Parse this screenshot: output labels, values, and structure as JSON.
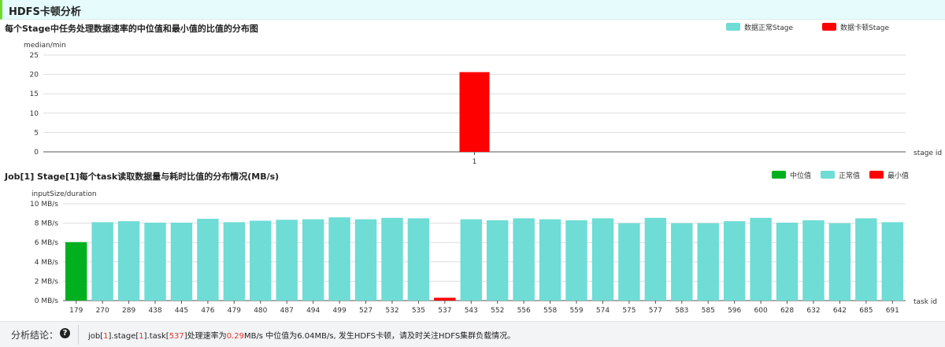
{
  "header": {
    "title": "HDFS卡顿分析"
  },
  "chart_data": [
    {
      "type": "bar",
      "title": "每个Stage中任务处理数据速率的中位值和最小值的比值的分布图",
      "ylabel": "median/min",
      "xlabel": "stage id",
      "ylim": [
        0,
        25
      ],
      "yticks": [
        0,
        5,
        10,
        15,
        20,
        25
      ],
      "grid": true,
      "legend_position": "top-right",
      "legend": [
        {
          "label": "数据正常Stage",
          "color": "#6fdcd6"
        },
        {
          "label": "数据卡顿Stage",
          "color": "#ff0000"
        }
      ],
      "categories": [
        "1"
      ],
      "series": [
        {
          "name": "数据卡顿Stage",
          "values": [
            20.6
          ],
          "color": "#ff0000"
        }
      ]
    },
    {
      "type": "bar",
      "title": "Job[1] Stage[1]每个task读取数据量与耗时比值的分布情况(MB/s)",
      "ylabel": "inputSize/duration",
      "xlabel": "task id",
      "ylim": [
        0,
        10
      ],
      "yticks": [
        "0 MB/s",
        "2 MB/s",
        "4 MB/s",
        "6 MB/s",
        "8 MB/s",
        "10 MB/s"
      ],
      "grid": true,
      "legend_position": "top-right",
      "legend": [
        {
          "label": "中位值",
          "color": "#00b01f"
        },
        {
          "label": "正常值",
          "color": "#6fdcd6"
        },
        {
          "label": "最小值",
          "color": "#ff0000"
        }
      ],
      "categories": [
        "179",
        "270",
        "289",
        "438",
        "445",
        "476",
        "479",
        "480",
        "487",
        "494",
        "499",
        "527",
        "532",
        "535",
        "537",
        "543",
        "552",
        "556",
        "558",
        "559",
        "574",
        "575",
        "577",
        "583",
        "585",
        "596",
        "600",
        "628",
        "632",
        "642",
        "685",
        "691"
      ],
      "values": [
        6.04,
        8.1,
        8.2,
        8.05,
        8.05,
        8.45,
        8.1,
        8.25,
        8.35,
        8.4,
        8.6,
        8.4,
        8.55,
        8.5,
        0.29,
        8.4,
        8.3,
        8.5,
        8.4,
        8.3,
        8.5,
        8.0,
        8.55,
        8.0,
        8.0,
        8.2,
        8.55,
        8.05,
        8.3,
        8.0,
        8.5,
        8.1
      ],
      "bar_colors": [
        "#00b01f",
        "#6fdcd6",
        "#6fdcd6",
        "#6fdcd6",
        "#6fdcd6",
        "#6fdcd6",
        "#6fdcd6",
        "#6fdcd6",
        "#6fdcd6",
        "#6fdcd6",
        "#6fdcd6",
        "#6fdcd6",
        "#6fdcd6",
        "#6fdcd6",
        "#ff0000",
        "#6fdcd6",
        "#6fdcd6",
        "#6fdcd6",
        "#6fdcd6",
        "#6fdcd6",
        "#6fdcd6",
        "#6fdcd6",
        "#6fdcd6",
        "#6fdcd6",
        "#6fdcd6",
        "#6fdcd6",
        "#6fdcd6",
        "#6fdcd6",
        "#6fdcd6",
        "#6fdcd6",
        "#6fdcd6",
        "#6fdcd6"
      ]
    }
  ],
  "footer": {
    "label": "分析结论：",
    "help_icon": "?",
    "conclusion": {
      "p1": "job[",
      "job_id": "1",
      "p2": "].stage[",
      "stage_id": "1",
      "p3": "].task[",
      "task_id": "537",
      "p4": "]处理速率为",
      "rate": "0.29",
      "p5": "MB/s 中位值为6.04MB/s, 发生HDFS卡顿，请及时关注HDFS集群负载情况。"
    }
  }
}
